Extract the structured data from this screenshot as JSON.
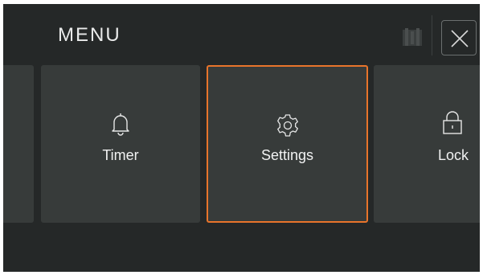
{
  "header": {
    "title": "MENU",
    "close_icon": "close-icon",
    "status_icon": "sd-card-icon"
  },
  "tiles": [
    {
      "label": "",
      "icon": ""
    },
    {
      "label": "Timer",
      "icon": "bell-icon"
    },
    {
      "label": "Settings",
      "icon": "gear-icon",
      "selected": true
    },
    {
      "label": "Lock",
      "icon": "padlock-icon"
    }
  ],
  "colors": {
    "background": "#252828",
    "tile": "#373b3a",
    "accent": "#e8742b",
    "text": "#f1f2f2"
  }
}
